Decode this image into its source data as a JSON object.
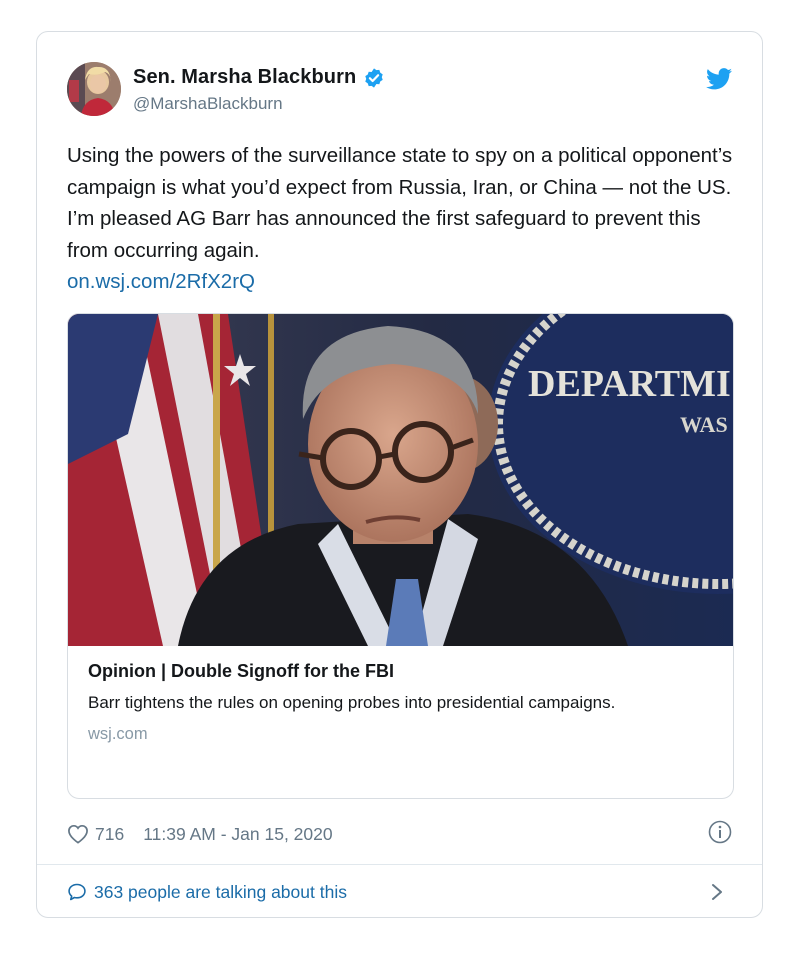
{
  "tweet": {
    "display_name": "Sen. Marsha Blackburn",
    "handle": "@MarshaBlackburn",
    "text": "Using the powers of the surveillance state to spy on a political opponent’s campaign is what you’d expect from Russia, Iran, or China — not the US. I’m pleased AG Barr has announced the first safeguard to prevent this from occurring again.",
    "link": "on.wsj.com/2RfX2rQ"
  },
  "card": {
    "title": "Opinion | Double Signoff for the FBI",
    "description": "Barr tightens the rules on opening probes into presidential campaigns.",
    "domain": "wsj.com",
    "photo_sign_line1": "DEPARTMI",
    "photo_sign_line2": "WAS"
  },
  "stats": {
    "likes": "716",
    "timestamp": "11:39 AM - Jan 15, 2020"
  },
  "footer": {
    "conversation": "363 people are talking about this"
  },
  "colors": {
    "link": "#1b6ca8",
    "verified": "#1da1f2",
    "twitter_brand": "#1da1f2",
    "muted": "#657786"
  },
  "icons": [
    "verified-badge-icon",
    "twitter-bird-icon",
    "heart-icon",
    "info-icon",
    "speech-bubble-icon",
    "chevron-right-icon"
  ]
}
